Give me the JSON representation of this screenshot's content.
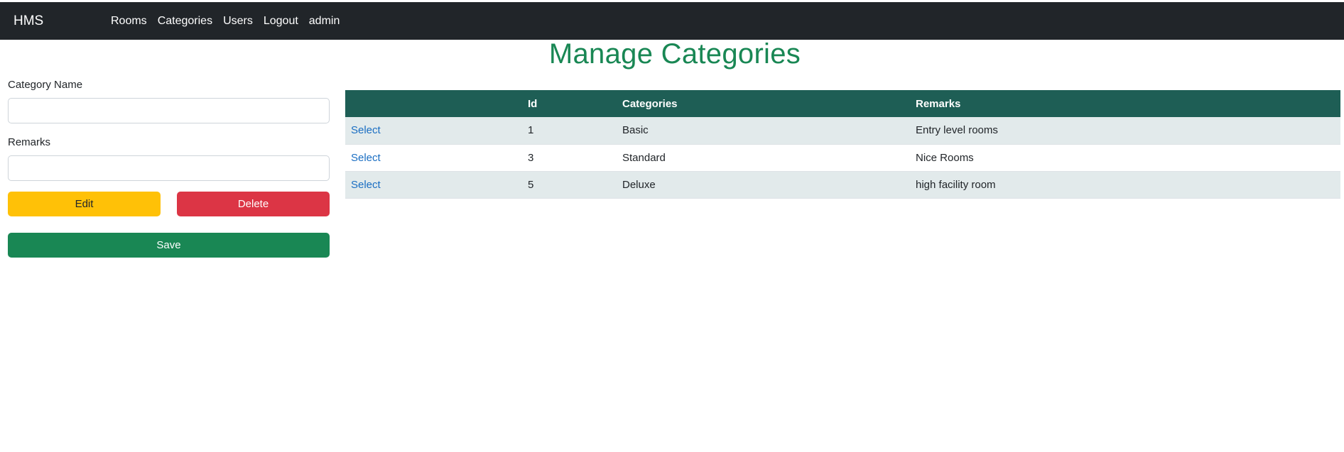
{
  "navbar": {
    "brand": "HMS",
    "links": [
      "Rooms",
      "Categories",
      "Users",
      "Logout",
      "admin"
    ]
  },
  "page": {
    "title": "Manage Categories"
  },
  "form": {
    "category_name_label": "Category Name",
    "category_name_value": "",
    "remarks_label": "Remarks",
    "remarks_value": "",
    "edit_label": "Edit",
    "delete_label": "Delete",
    "save_label": "Save"
  },
  "table": {
    "headers": [
      "",
      "Id",
      "Categories",
      "Remarks"
    ],
    "rows": [
      {
        "action": "Select",
        "id": "1",
        "category": "Basic",
        "remarks": "Entry level rooms"
      },
      {
        "action": "Select",
        "id": "3",
        "category": "Standard",
        "remarks": "Nice Rooms"
      },
      {
        "action": "Select",
        "id": "5",
        "category": "Deluxe",
        "remarks": "high facility room"
      }
    ]
  },
  "colors": {
    "navbar_bg": "#212529",
    "title_green": "#198754",
    "table_header_bg": "#1e5e55",
    "edit_yellow": "#ffc107",
    "delete_red": "#dc3545",
    "save_green": "#198754"
  }
}
